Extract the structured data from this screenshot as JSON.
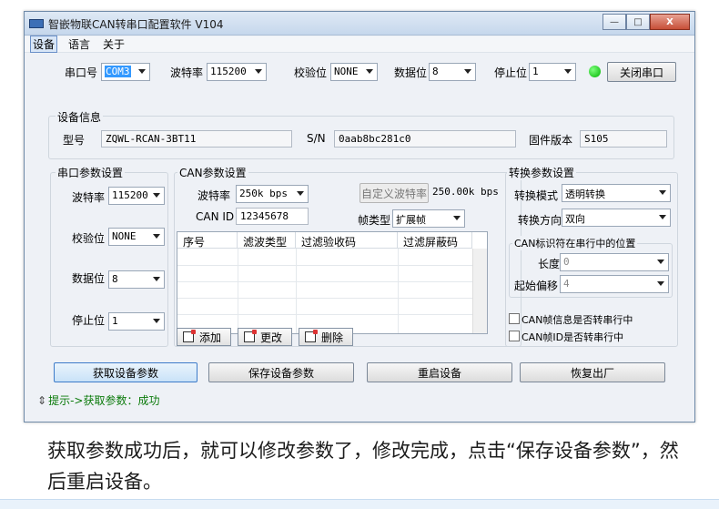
{
  "window": {
    "title": "智嵌物联CAN转串口配置软件  V104",
    "min_label": "—",
    "max_label": "□",
    "close_label": "X"
  },
  "menu": {
    "device": "设备",
    "language": "语言",
    "about": "关于"
  },
  "serial_top": {
    "port_label": "串口号",
    "port_value": "COM3",
    "baud_label": "波特率",
    "baud_value": "115200",
    "parity_label": "校验位",
    "parity_value": "NONE",
    "databits_label": "数据位",
    "databits_value": "8",
    "stopbits_label": "停止位",
    "stopbits_value": "1",
    "close_port_label": "关闭串口",
    "status_color": "#00c000"
  },
  "device_info": {
    "group_title": "设备信息",
    "model_label": "型号",
    "model_value": "ZQWL-RCAN-3BT11",
    "sn_label": "S/N",
    "sn_value": "0aab8bc281c0",
    "fw_label": "固件版本",
    "fw_value": "S105"
  },
  "serial_params": {
    "group_title": "串口参数设置",
    "baud_label": "波特率",
    "baud_value": "115200",
    "parity_label": "校验位",
    "parity_value": "NONE",
    "databits_label": "数据位",
    "databits_value": "8",
    "stopbits_label": "停止位",
    "stopbits_value": "1"
  },
  "can_params": {
    "group_title": "CAN参数设置",
    "baud_label": "波特率",
    "baud_value": "250k  bps",
    "custom_baud_label": "自定义波特率",
    "custom_baud_value": "250.00k bps",
    "canid_label": "CAN ID",
    "canid_value": "12345678",
    "frame_type_label": "帧类型",
    "frame_type_value": "扩展帧",
    "table_headers": [
      "序号",
      "滤波类型",
      "过滤验收码",
      "过滤屏蔽码"
    ],
    "add_label": "添加",
    "edit_label": "更改",
    "delete_label": "删除"
  },
  "convert_params": {
    "group_title": "转换参数设置",
    "mode_label": "转换模式",
    "mode_value": "透明转换",
    "direction_label": "转换方向",
    "direction_value": "双向",
    "canid_pos_title": "CAN标识符在串行中的位置",
    "length_label": "长度",
    "length_value": "0",
    "offset_label": "起始偏移",
    "offset_value": "4",
    "check1_label": "CAN帧信息是否转串行中",
    "check2_label": "CAN帧ID是否转串行中"
  },
  "actions": {
    "get_label": "获取设备参数",
    "save_label": "保存设备参数",
    "restart_label": "重启设备",
    "restore_label": "恢复出厂"
  },
  "status_text": "提示->获取参数：成功",
  "caption": "获取参数成功后，就可以修改参数了，修改完成，点击“保存设备参数”，然后重启设备。"
}
